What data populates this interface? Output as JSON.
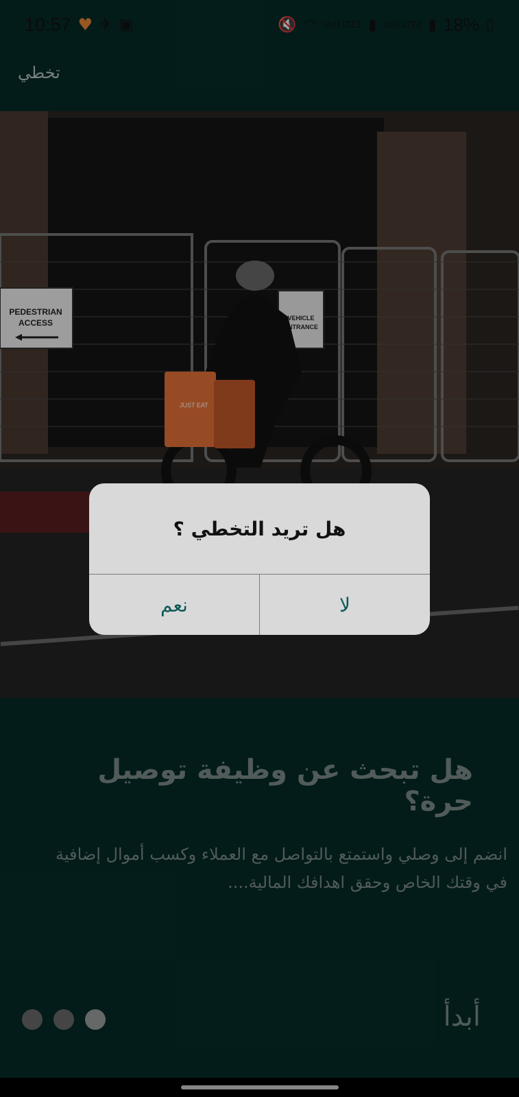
{
  "status_bar": {
    "time": "10:57",
    "battery_percent": "18%",
    "network_labels": [
      "Vo)) LTE1",
      "Vo)) LTE2"
    ]
  },
  "skip": {
    "label": "تخطي"
  },
  "hero_image": {
    "signs": [
      "PEDESTRIAN ACCESS",
      "VEHICLE ENTRANCE"
    ],
    "bag_text": "JUST EAT"
  },
  "onboarding": {
    "headline": "هل تبحث عن وظيفة توصيل حرة؟",
    "description": "انضم إلى وصلي واستمتع بالتواصل مع العملاء وكسب أموال إضافية في وقتك الخاص وحقق اهدافك المالية....",
    "start_label": "أبدأ",
    "page_count": 3,
    "active_page": 3
  },
  "dialog": {
    "title": "هل تريد التخطي ؟",
    "yes_label": "نعم",
    "no_label": "لا"
  },
  "colors": {
    "background": "#062b28",
    "accent": "#0d5a55",
    "bag_orange": "#e8733a"
  }
}
